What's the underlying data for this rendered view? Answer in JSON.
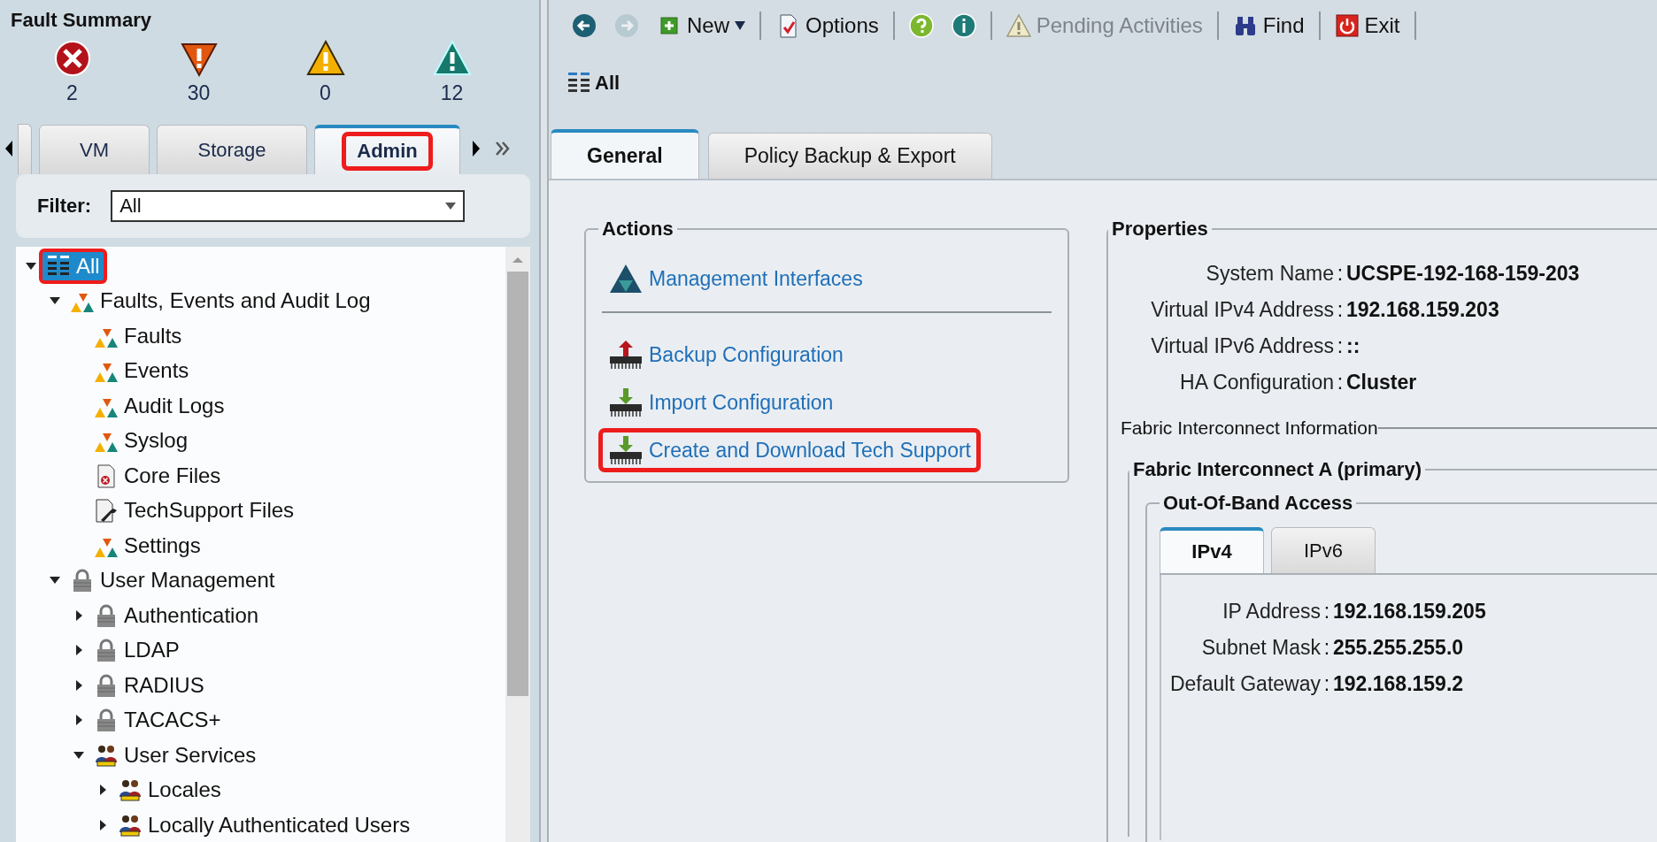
{
  "fault_summary": {
    "title": "Fault Summary",
    "counts": [
      {
        "kind": "critical",
        "count": "2"
      },
      {
        "kind": "major",
        "count": "30"
      },
      {
        "kind": "minor",
        "count": "0"
      },
      {
        "kind": "warning",
        "count": "12"
      }
    ]
  },
  "nav_tabs": [
    {
      "label": "VM",
      "selected": false,
      "highlighted": false
    },
    {
      "label": "Storage",
      "selected": false,
      "highlighted": false
    },
    {
      "label": "Admin",
      "selected": true,
      "highlighted": true
    }
  ],
  "filter": {
    "label": "Filter:",
    "value": "All"
  },
  "tree": [
    {
      "label": "All",
      "kind": "list",
      "expanded": true,
      "selected": true,
      "highlighted": true,
      "children": [
        {
          "label": "Faults, Events and Audit Log",
          "kind": "faults",
          "expanded": true,
          "selected": false,
          "highlighted": false,
          "children": [
            {
              "label": "Faults",
              "kind": "faults",
              "selected": false,
              "highlighted": false
            },
            {
              "label": "Events",
              "kind": "faults",
              "selected": false,
              "highlighted": false
            },
            {
              "label": "Audit Logs",
              "kind": "faults",
              "selected": false,
              "highlighted": false
            },
            {
              "label": "Syslog",
              "kind": "faults",
              "selected": false,
              "highlighted": false
            },
            {
              "label": "Core Files",
              "kind": "core-file",
              "selected": false,
              "highlighted": false
            },
            {
              "label": "TechSupport Files",
              "kind": "tools-file",
              "selected": false,
              "highlighted": false
            },
            {
              "label": "Settings",
              "kind": "faults",
              "selected": false,
              "highlighted": false
            }
          ]
        },
        {
          "label": "User Management",
          "kind": "lock",
          "expanded": true,
          "selected": false,
          "highlighted": false,
          "children": [
            {
              "label": "Authentication",
              "kind": "lock",
              "expanded": false,
              "selected": false,
              "highlighted": false
            },
            {
              "label": "LDAP",
              "kind": "lock",
              "expanded": false,
              "selected": false,
              "highlighted": false
            },
            {
              "label": "RADIUS",
              "kind": "lock",
              "expanded": false,
              "selected": false,
              "highlighted": false
            },
            {
              "label": "TACACS+",
              "kind": "lock",
              "expanded": false,
              "selected": false,
              "highlighted": false
            },
            {
              "label": "User Services",
              "kind": "users",
              "expanded": true,
              "selected": false,
              "highlighted": false,
              "children": [
                {
                  "label": "Locales",
                  "kind": "users",
                  "expanded": false,
                  "selected": false,
                  "highlighted": false
                },
                {
                  "label": "Locally Authenticated Users",
                  "kind": "users",
                  "expanded": false,
                  "selected": false,
                  "highlighted": false
                }
              ]
            }
          ]
        }
      ]
    }
  ],
  "toolbar": [
    {
      "kind": "back",
      "disabled": false
    },
    {
      "kind": "forward",
      "disabled": true
    },
    {
      "kind": "new",
      "label": "New",
      "disabled": false
    },
    {
      "kind": "separator"
    },
    {
      "kind": "options",
      "label": "Options",
      "disabled": false
    },
    {
      "kind": "separator"
    },
    {
      "kind": "help",
      "disabled": false
    },
    {
      "kind": "info",
      "disabled": false
    },
    {
      "kind": "separator"
    },
    {
      "kind": "pending",
      "label": "Pending Activities",
      "disabled": true
    },
    {
      "kind": "separator"
    },
    {
      "kind": "find",
      "label": "Find",
      "disabled": false
    },
    {
      "kind": "separator"
    },
    {
      "kind": "exit",
      "label": "Exit",
      "disabled": false
    },
    {
      "kind": "separator"
    }
  ],
  "breadcrumb": {
    "label": "All"
  },
  "content_tabs": [
    {
      "label": "General",
      "selected": true
    },
    {
      "label": "Policy Backup & Export",
      "selected": false
    }
  ],
  "actions": {
    "title": "Actions",
    "groups": [
      [
        {
          "kind": "management",
          "label": "Management Interfaces",
          "highlighted": false
        }
      ],
      [
        {
          "kind": "upload",
          "label": "Backup Configuration",
          "highlighted": false
        },
        {
          "kind": "download",
          "label": "Import Configuration",
          "highlighted": false
        },
        {
          "kind": "download",
          "label": "Create and Download Tech Support",
          "highlighted": true
        }
      ]
    ]
  },
  "properties": {
    "title": "Properties",
    "rows": [
      {
        "label": "System Name",
        "separator": ":",
        "value": "UCSPE-192-168-159-203"
      },
      {
        "label": "Virtual IPv4 Address",
        "separator": ":",
        "value": "192.168.159.203"
      },
      {
        "label": "Virtual IPv6 Address",
        "separator": ":",
        "value": "::"
      },
      {
        "label": "HA Configuration",
        "separator": ":",
        "value": "Cluster"
      }
    ],
    "fabric_info": {
      "title": "Fabric Interconnect Information",
      "interconnect": {
        "title": "Fabric Interconnect A (primary)",
        "out_of_band": {
          "title": "Out-Of-Band Access",
          "tabs": [
            {
              "label": "IPv4",
              "selected": true
            },
            {
              "label": "IPv6",
              "selected": false
            }
          ],
          "rows": [
            {
              "label": "IP Address",
              "separator": ":",
              "value": "192.168.159.205"
            },
            {
              "label": "Subnet Mask",
              "separator": ":",
              "value": "255.255.255.0"
            },
            {
              "label": "Default Gateway",
              "separator": ":",
              "value": "192.168.159.2"
            }
          ]
        }
      }
    }
  }
}
